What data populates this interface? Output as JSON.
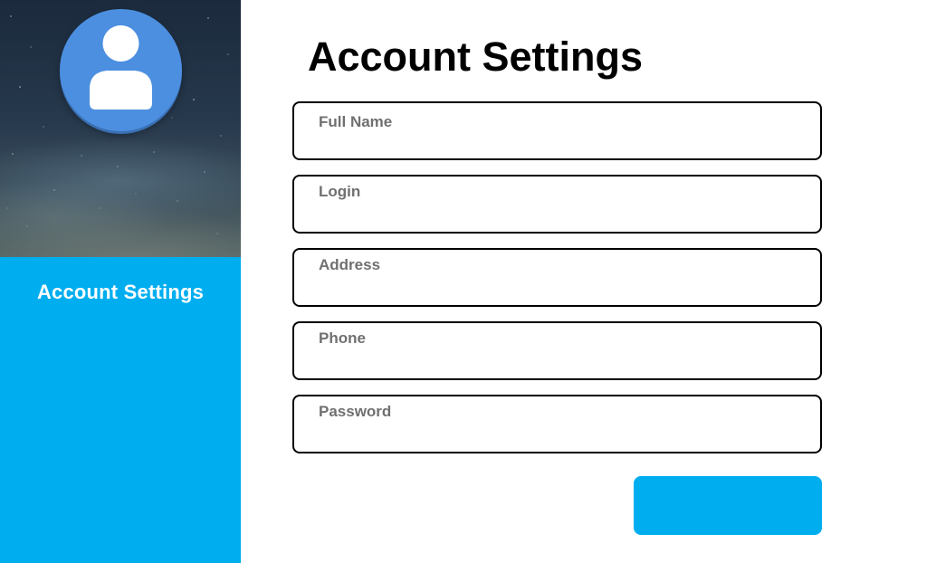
{
  "sidebar": {
    "title": "Account Settings",
    "avatar_icon": "user-avatar-icon",
    "accent_color": "#00aeef",
    "avatar_color": "#4c8fe0"
  },
  "main": {
    "title": "Account Settings",
    "fields": [
      {
        "label": "Full Name",
        "value": ""
      },
      {
        "label": "Login",
        "value": ""
      },
      {
        "label": "Address",
        "value": ""
      },
      {
        "label": "Phone",
        "value": ""
      },
      {
        "label": "Password",
        "value": ""
      }
    ],
    "save_button_label": ""
  }
}
